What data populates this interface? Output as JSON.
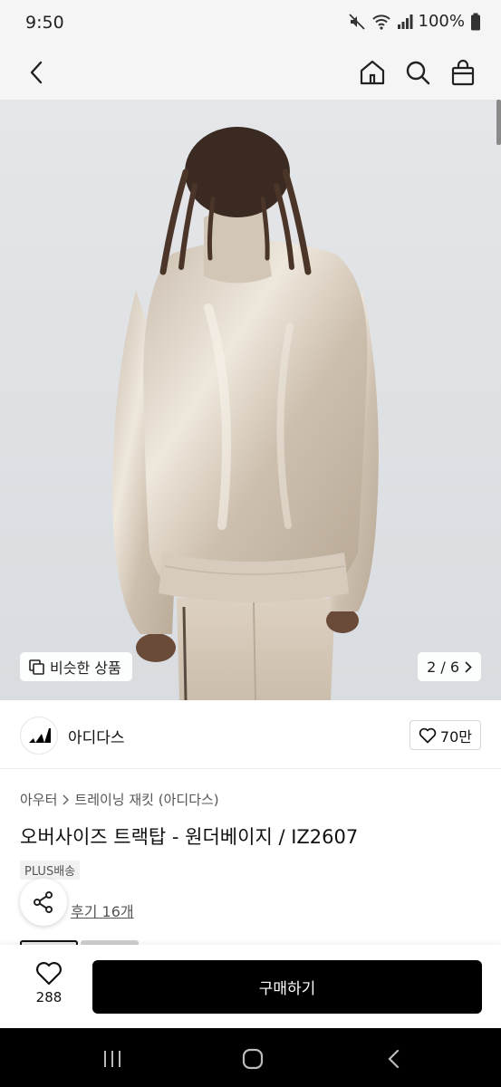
{
  "status_bar": {
    "time": "9:50",
    "battery": "100%"
  },
  "header": {
    "icons": [
      "back-icon",
      "home-icon",
      "search-icon",
      "bag-icon"
    ]
  },
  "image": {
    "current": "2",
    "total": "6",
    "counter": "2 / 6",
    "similar_label": "비슷한 상품"
  },
  "brand": {
    "name": "아디다스",
    "likes": "70만"
  },
  "breadcrumb": [
    "아우터",
    "트레이닝 재킷 (아디다스)"
  ],
  "product": {
    "title": "오버사이즈 트랙탑 - 원더베이지 / IZ2607",
    "shipping_badge": "PLUS배송",
    "review_label": "후기 16개"
  },
  "bottom": {
    "wish_count": "288",
    "buy_label": "구매하기"
  },
  "colors": {
    "accent": "#000000",
    "jacket": "#d9cfc2"
  }
}
